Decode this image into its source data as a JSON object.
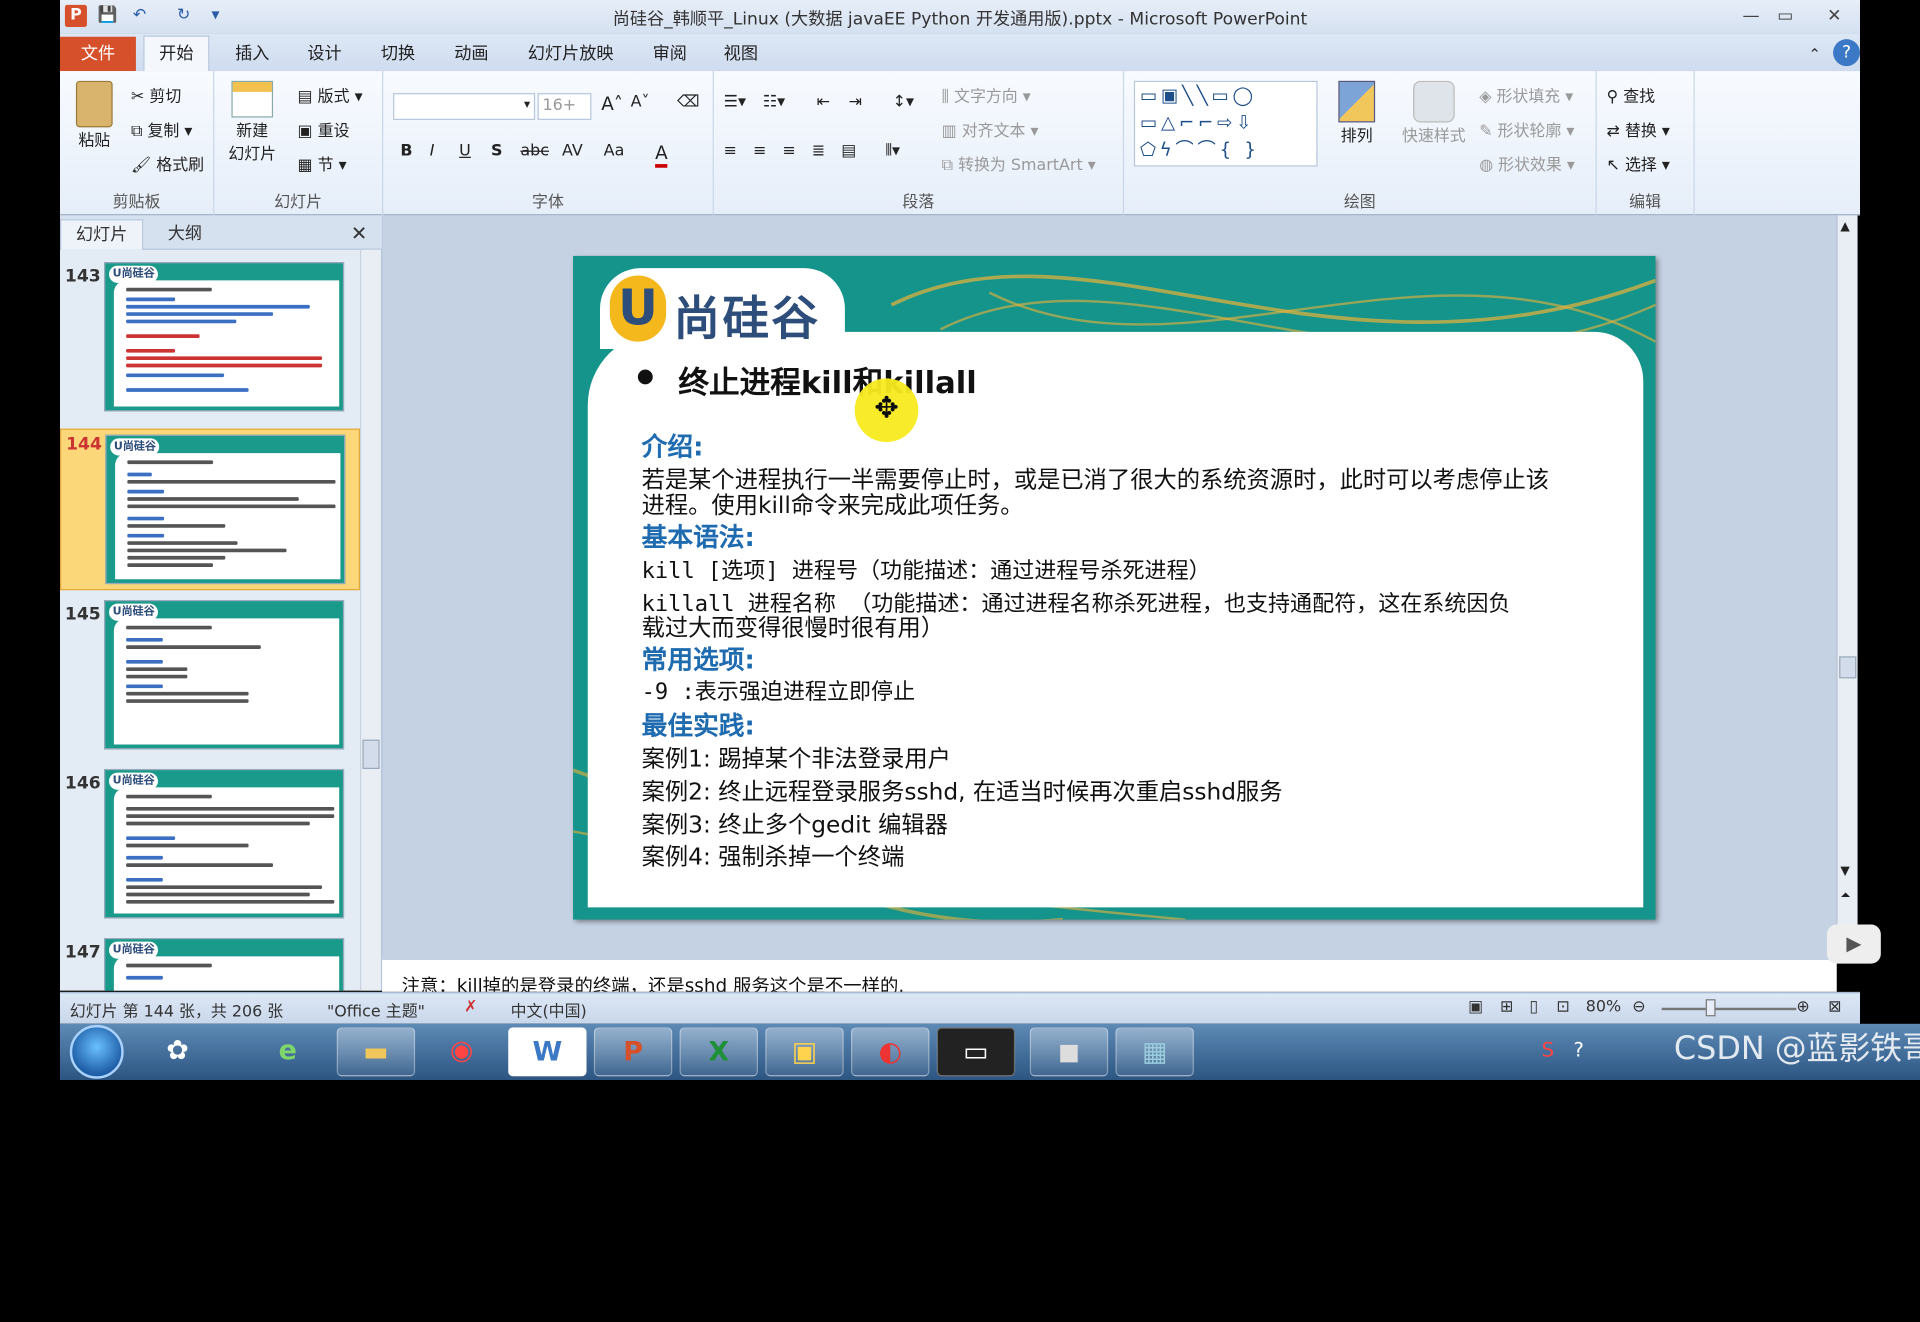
{
  "window": {
    "title": "尚硅谷_韩顺平_Linux (大数据 javaEE Python 开发通用版).pptx - Microsoft PowerPoint",
    "app_icon": "P",
    "controls": {
      "minimize": "—",
      "restore": "▭",
      "close": "✕"
    }
  },
  "ribbon_tabs": [
    "文件",
    "开始",
    "插入",
    "设计",
    "切换",
    "动画",
    "幻灯片放映",
    "审阅",
    "视图"
  ],
  "ribbon": {
    "clipboard": {
      "paste": "粘贴",
      "cut": "剪切",
      "copy": "复制",
      "format_painter": "格式刷",
      "label": "剪贴板"
    },
    "slides": {
      "new_slide": "新建",
      "new_slide2": "幻灯片",
      "layout": "版式",
      "reset": "重设",
      "section": "节",
      "label": "幻灯片"
    },
    "font": {
      "font_size": "16+",
      "bold": "B",
      "italic": "I",
      "underline": "U",
      "shadow": "S",
      "strike": "abc",
      "spacing": "AV",
      "case": "Aa",
      "color": "A",
      "label": "字体"
    },
    "paragraph": {
      "text_direction": "文字方向",
      "align_text": "对齐文本",
      "smartart": "转换为 SmartArt",
      "label": "段落"
    },
    "drawing": {
      "arrange": "排列",
      "quick_styles": "快速样式",
      "shape_fill": "形状填充",
      "shape_outline": "形状轮廓",
      "shape_effects": "形状效果",
      "label": "绘图"
    },
    "editing": {
      "find": "查找",
      "replace": "替换",
      "select": "选择",
      "label": "编辑"
    }
  },
  "pane_tabs": {
    "slides": "幻灯片",
    "outline": "大纲"
  },
  "thumbnails": [
    {
      "num": "143",
      "selected": false
    },
    {
      "num": "144",
      "selected": true
    },
    {
      "num": "145",
      "selected": false
    },
    {
      "num": "146",
      "selected": false
    },
    {
      "num": "147",
      "selected": false
    }
  ],
  "slide": {
    "logo_u": "U",
    "logo_text": "尚硅谷",
    "bullet": "●",
    "heading": "终止进程kill和killall",
    "intro_label": "介绍:",
    "intro_line1": "若是某个进程执行一半需要停止时，或是已消了很大的系统资源时，此时可以考虑停止该",
    "intro_line2": "进程。使用kill命令来完成此项任务。",
    "syntax_label": "基本语法:",
    "syntax1": "kill  [选项] 进程号（功能描述：通过进程号杀死进程）",
    "syntax2_line1": "killall 进程名称  （功能描述：通过进程名称杀死进程，也支持通配符，这在系统因负",
    "syntax2_line2": "载过大而变得很慢时很有用）",
    "options_label": "常用选项:",
    "option1": "-9 :表示强迫进程立即停止",
    "practice_label": "最佳实践:",
    "case1": "案例1: 踢掉某个非法登录用户",
    "case2": "案例2: 终止远程登录服务sshd, 在适当时候再次重启sshd服务",
    "case3": "案例3: 终止多个gedit 编辑器",
    "case4": "案例4: 强制杀掉一个终端"
  },
  "notes": "注意：kill掉的是登录的终端，还是sshd 服务这个是不一样的.",
  "statusbar": {
    "slide_info": "幻灯片 第 144 张，共 206 张",
    "theme": "\"Office 主题\"",
    "language": "中文(中国)",
    "zoom": "80%"
  },
  "taskbar": {
    "apps": [
      "ie-icon",
      "folder-icon",
      "chrome-icon",
      "word-icon",
      "powerpoint-icon",
      "excel-icon",
      "notepad-icon",
      "app-icon",
      "terminal-icon",
      "camera-icon",
      "vm-icon"
    ],
    "watermark": "CSDN @蓝影铁哥"
  },
  "colors": {
    "accent": "#d6502b",
    "slide_teal": "#14948a",
    "heading_blue": "#1f6bb0",
    "selection": "#fbd77a"
  }
}
